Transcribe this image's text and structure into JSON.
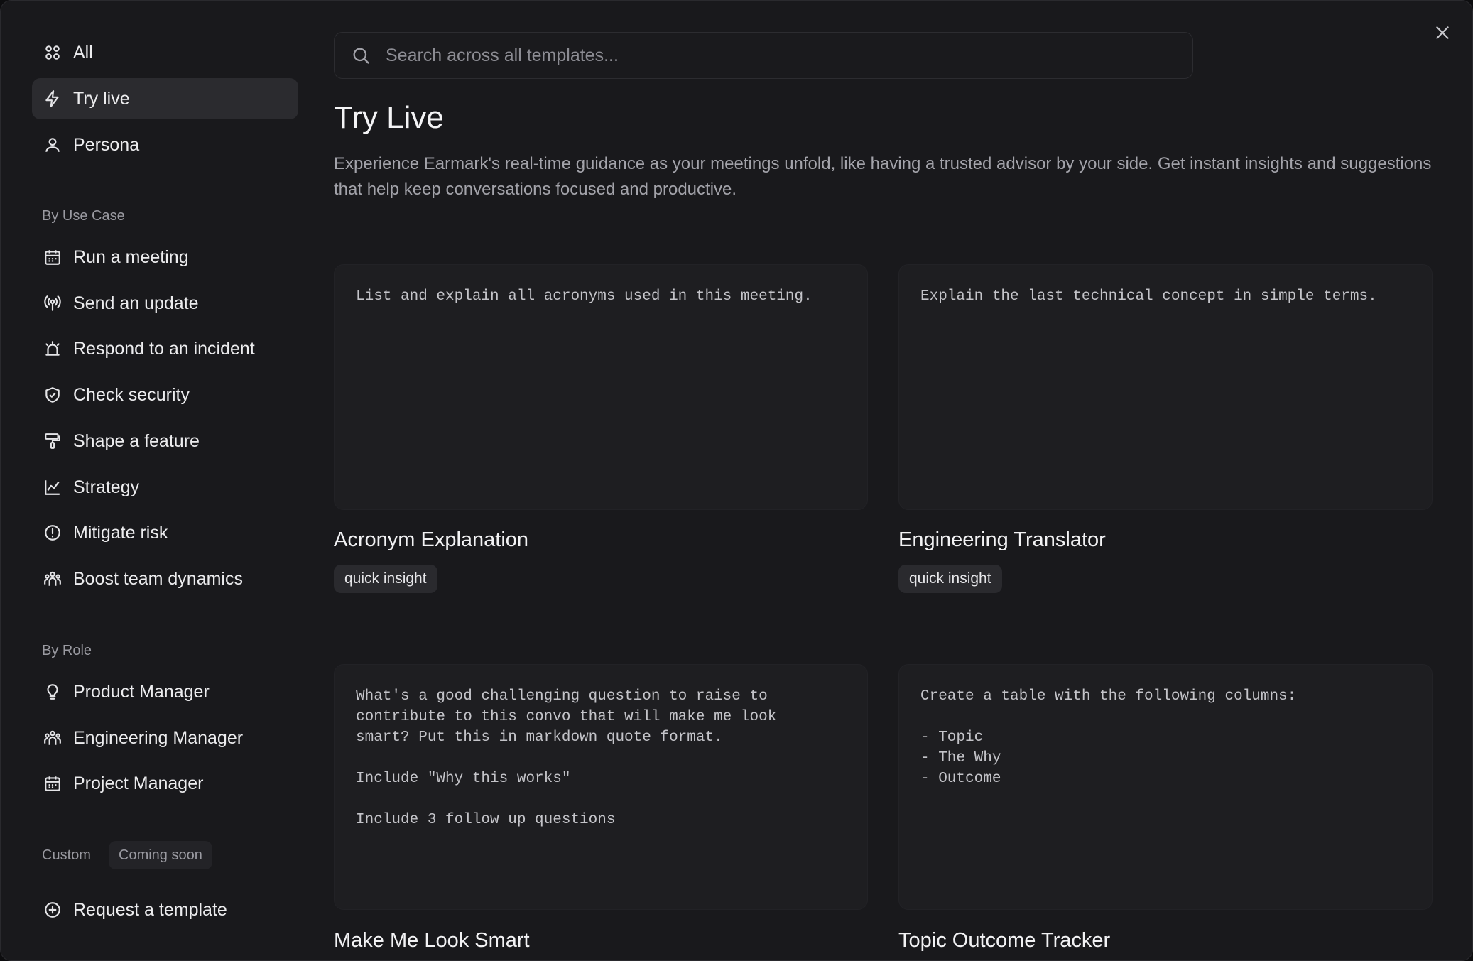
{
  "sidebar": {
    "top_items": [
      {
        "label": "All",
        "icon": "grid-icon"
      },
      {
        "label": "Try live",
        "icon": "lightning-icon"
      },
      {
        "label": "Persona",
        "icon": "person-icon"
      }
    ],
    "use_case_header": "By Use Case",
    "use_case_items": [
      {
        "label": "Run a meeting",
        "icon": "calendar-icon"
      },
      {
        "label": "Send an update",
        "icon": "broadcast-icon"
      },
      {
        "label": "Respond to an incident",
        "icon": "siren-icon"
      },
      {
        "label": "Check security",
        "icon": "shield-check-icon"
      },
      {
        "label": "Shape a feature",
        "icon": "paint-roller-icon"
      },
      {
        "label": "Strategy",
        "icon": "line-chart-icon"
      },
      {
        "label": "Mitigate risk",
        "icon": "alert-circle-icon"
      },
      {
        "label": "Boost team dynamics",
        "icon": "team-icon"
      }
    ],
    "role_header": "By Role",
    "role_items": [
      {
        "label": "Product Manager",
        "icon": "lightbulb-icon"
      },
      {
        "label": "Engineering Manager",
        "icon": "team-icon"
      },
      {
        "label": "Project Manager",
        "icon": "calendar-icon"
      }
    ],
    "custom_header": "Custom",
    "custom_badge": "Coming soon",
    "request_label": "Request a template"
  },
  "search": {
    "placeholder": "Search across all templates..."
  },
  "page": {
    "title": "Try Live",
    "description": "Experience Earmark's real-time guidance as your meetings unfold, like having a trusted advisor by your side. Get instant insights and suggestions that help keep conversations focused and productive."
  },
  "cards": [
    {
      "prompt": "List and explain all acronyms used in this meeting.",
      "title": "Acronym Explanation",
      "tag": "quick insight"
    },
    {
      "prompt": "Explain the last technical concept in simple terms.",
      "title": "Engineering Translator",
      "tag": "quick insight"
    },
    {
      "prompt": "What's a good challenging question to raise to\ncontribute to this convo that will make me look\nsmart? Put this in markdown quote format.\n\nInclude \"Why this works\"\n\nInclude 3 follow up questions",
      "title": "Make Me Look Smart"
    },
    {
      "prompt": "Create a table with the following columns:\n\n- Topic\n- The Why\n- Outcome",
      "title": "Topic Outcome Tracker"
    }
  ]
}
